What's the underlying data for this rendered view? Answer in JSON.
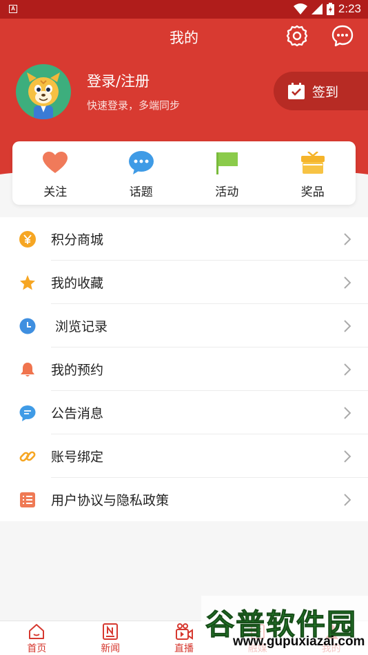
{
  "status_bar": {
    "time": "2:23"
  },
  "header": {
    "title": "我的",
    "login_title": "登录/注册",
    "login_subtitle": "快速登录，多端同步",
    "checkin_label": "签到",
    "accent_color": "#d83a31"
  },
  "quick_actions": [
    {
      "label": "关注",
      "icon": "heart-icon"
    },
    {
      "label": "话题",
      "icon": "chat-bubble-icon"
    },
    {
      "label": "活动",
      "icon": "flag-icon"
    },
    {
      "label": "奖品",
      "icon": "gift-icon"
    }
  ],
  "menu": [
    {
      "label": "积分商城",
      "icon": "yen-coin-icon"
    },
    {
      "label": "我的收藏",
      "icon": "star-icon"
    },
    {
      "label": "浏览记录",
      "icon": "clock-icon"
    },
    {
      "label": "我的预约",
      "icon": "bell-icon"
    },
    {
      "label": "公告消息",
      "icon": "message-icon"
    },
    {
      "label": "账号绑定",
      "icon": "link-icon"
    },
    {
      "label": "用户协议与隐私政策",
      "icon": "document-list-icon"
    }
  ],
  "bottom_nav": [
    {
      "label": "首页",
      "icon": "home-icon"
    },
    {
      "label": "新闻",
      "icon": "news-icon"
    },
    {
      "label": "直播",
      "icon": "live-camera-icon"
    },
    {
      "label": "融媒",
      "icon": "media-icon"
    },
    {
      "label": "我的",
      "icon": "profile-icon"
    }
  ],
  "watermark": {
    "text": "谷普软件园",
    "url": "www.gupuxiazai.com"
  }
}
